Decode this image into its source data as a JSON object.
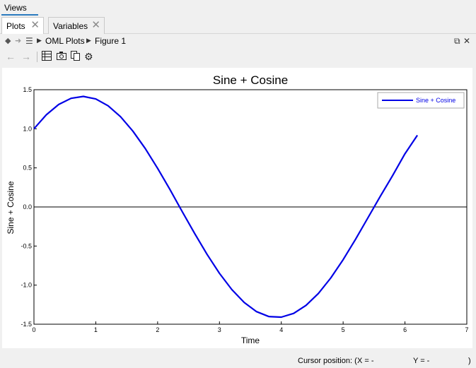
{
  "views": {
    "title": "Views"
  },
  "tabs": [
    {
      "label": "Plots",
      "active": true
    },
    {
      "label": "Variables",
      "active": false
    }
  ],
  "breadcrumb": [
    "OML Plots",
    "Figure 1"
  ],
  "toolbar": {
    "icons": [
      "back-arrow-icon",
      "forward-arrow-icon",
      "table-icon",
      "camera-icon",
      "copy-icon",
      "gear-icon"
    ]
  },
  "status": {
    "cursor_label": "Cursor position: (",
    "x_label": "X = -",
    "y_label": "Y = -",
    "close_paren": ")"
  },
  "chart_data": {
    "type": "line",
    "title": "Sine + Cosine",
    "xlabel": "Time",
    "ylabel": "Sine + Cosine",
    "xlim": [
      0,
      7
    ],
    "ylim": [
      -1.5,
      1.5
    ],
    "xticks": [
      "0",
      "1",
      "2",
      "3",
      "4",
      "5",
      "6",
      "7"
    ],
    "yticks": [
      "1.5",
      "1.0",
      "0.5",
      "0.0",
      "-0.5",
      "-1.0",
      "-1.5"
    ],
    "zero_line": true,
    "grid": false,
    "legend_position": "top-right",
    "line_color": "#0000e6",
    "series": [
      {
        "name": "Sine + Cosine",
        "x": [
          0,
          0.2,
          0.4,
          0.6,
          0.8,
          1.0,
          1.2,
          1.4,
          1.6,
          1.8,
          2.0,
          2.2,
          2.4,
          2.6,
          2.8,
          3.0,
          3.2,
          3.4,
          3.6,
          3.8,
          4.0,
          4.2,
          4.4,
          4.6,
          4.8,
          5.0,
          5.2,
          5.4,
          5.6,
          5.8,
          6.0,
          6.2
        ],
        "y": [
          1.0,
          1.179,
          1.311,
          1.39,
          1.414,
          1.382,
          1.294,
          1.155,
          0.97,
          0.747,
          0.493,
          0.223,
          -0.062,
          -0.341,
          -0.607,
          -0.849,
          -1.057,
          -1.222,
          -1.339,
          -1.402,
          -1.41,
          -1.362,
          -1.259,
          -1.106,
          -0.908,
          -0.675,
          -0.415,
          -0.14,
          0.135,
          0.401,
          0.681,
          0.917
        ]
      }
    ]
  }
}
